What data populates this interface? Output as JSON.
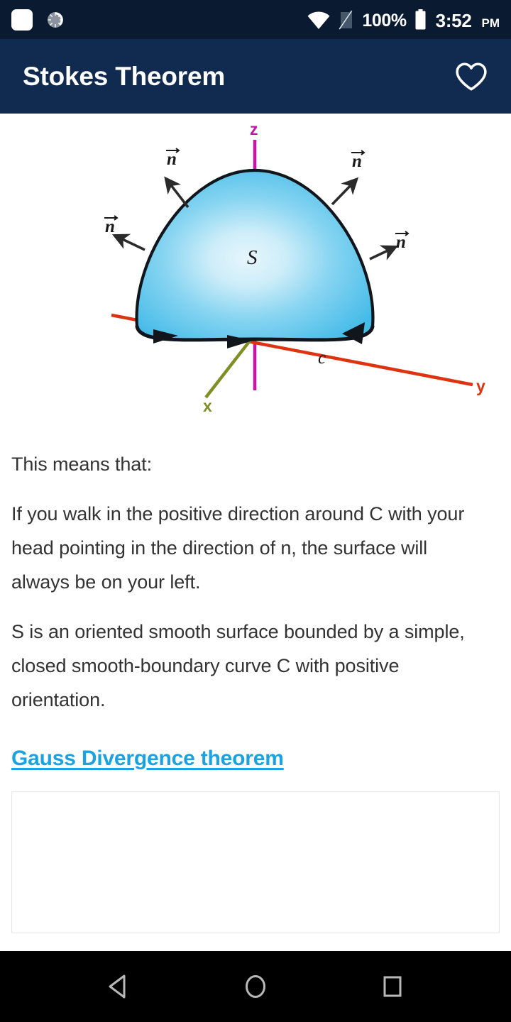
{
  "status_bar": {
    "background": "#0a1a30",
    "left_icons": [
      {
        "name": "app-notification-icon",
        "glyph": "rounded-square"
      },
      {
        "name": "sync-spinner-icon",
        "glyph": "dashed-circle"
      }
    ],
    "right_icons": [
      {
        "name": "wifi-icon",
        "glyph": "wifi-full"
      },
      {
        "name": "no-sim-icon",
        "glyph": "sim-slash"
      }
    ],
    "battery_percent": "100%",
    "battery_icon": "battery-full-icon",
    "time": "3:52",
    "am_pm": "PM"
  },
  "app_bar": {
    "background": "#102a50",
    "title": "Stokes Theorem",
    "favorite_icon": "heart-outline-icon"
  },
  "figure": {
    "alt_name": "stokes-theorem-diagram",
    "surface_label": "S",
    "curve_label": "c",
    "normal_labels": [
      "n",
      "n",
      "n",
      "n"
    ],
    "normal_label_display": "n⃗",
    "axes": [
      {
        "name": "z",
        "label": "z",
        "color": "#cc11aa"
      },
      {
        "name": "y",
        "label": "y",
        "color": "#dd3311"
      },
      {
        "name": "x",
        "label": "x",
        "color": "#7f8f24"
      }
    ],
    "surface_fill_center": "#ddf2fb",
    "surface_fill_edge": "#45bbe8",
    "outline_color": "#10161c"
  },
  "body": {
    "paragraphs": [
      "This means that:",
      "If you walk in the positive direction around C with your head pointing in the direction of n, the surface will always be on your left.",
      "S is an oriented smooth surface bounded by a simple, closed smooth-boundary curve C with positive orientation."
    ],
    "link_label": "Gauss Divergence theorem",
    "link_color": "#1aa3e0",
    "ad_placeholder_label": ""
  },
  "nav_bar": {
    "background": "#000000",
    "buttons": [
      {
        "name": "back-button",
        "icon": "triangle-left-icon"
      },
      {
        "name": "home-button",
        "icon": "circle-icon"
      },
      {
        "name": "recents-button",
        "icon": "square-icon"
      }
    ]
  }
}
